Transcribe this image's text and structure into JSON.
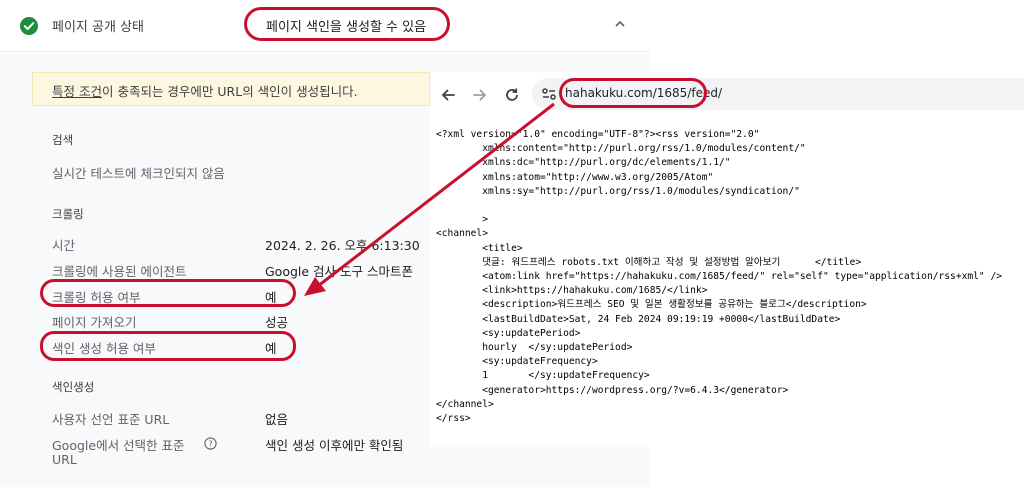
{
  "status": {
    "label": "페이지 공개 상태",
    "value": "페이지 색인을 생성할 수 있음"
  },
  "notice": {
    "link_text": "특정 조건",
    "rest_text": "이 충족되는 경우에만 URL의 색인이 생성됩니다."
  },
  "sections": {
    "search": {
      "title": "검색",
      "realtime": "실시간 테스트에 체크인되지 않음"
    },
    "crawling": {
      "title": "크롤링",
      "rows": [
        {
          "label": "시간",
          "value": "2024. 2. 26. 오후 6:13:30"
        },
        {
          "label": "크롤링에 사용된 에이전트",
          "value": "Google 검사 도구 스마트폰"
        },
        {
          "label": "크롤링 허용 여부",
          "value": "예"
        },
        {
          "label": "페이지 가져오기",
          "value": "성공"
        },
        {
          "label": "색인 생성 허용 여부",
          "value": "예"
        }
      ]
    },
    "indexing": {
      "title": "색인생성",
      "rows": [
        {
          "label": "사용자 선언 표준 URL",
          "value": "없음"
        },
        {
          "label": "Google에서 선택한 표준",
          "label2": "URL",
          "value": "색인 생성 이후에만 확인됨"
        }
      ]
    }
  },
  "browser": {
    "url": "hahakuku.com/1685/feed/",
    "xml_lines": [
      "<?xml version=\"1.0\" encoding=\"UTF-8\"?><rss version=\"2.0\"",
      "        xmlns:content=\"http://purl.org/rss/1.0/modules/content/\"",
      "        xmlns:dc=\"http://purl.org/dc/elements/1.1/\"",
      "        xmlns:atom=\"http://www.w3.org/2005/Atom\"",
      "        xmlns:sy=\"http://purl.org/rss/1.0/modules/syndication/\"",
      "",
      "        >",
      "<channel>",
      "        <title>",
      "        댓글: 워드프레스 robots.txt 이해하고 작성 및 설정방법 알아보기      </title>",
      "        <atom:link href=\"https://hahakuku.com/1685/feed/\" rel=\"self\" type=\"application/rss+xml\" />",
      "        <link>https://hahakuku.com/1685/</link>",
      "        <description>워드프레스 SEO 및 일본 생활정보를 공유하는 블로그</description>",
      "        <lastBuildDate>Sat, 24 Feb 2024 09:19:19 +0000</lastBuildDate>",
      "        <sy:updatePeriod>",
      "        hourly  </sy:updatePeriod>",
      "        <sy:updateFrequency>",
      "        1       </sy:updateFrequency>",
      "        <generator>https://wordpress.org/?v=6.4.3</generator>",
      "</channel>",
      "</rss>"
    ]
  },
  "colors": {
    "check_green": "#1e8e3e",
    "annotation_red": "#c8102e",
    "notice_bg": "#fef7e0"
  },
  "icons": [
    "check-circle-icon",
    "chevron-up-icon",
    "help-circle-icon",
    "back-arrow-icon",
    "forward-arrow-icon",
    "reload-icon",
    "site-settings-icon"
  ]
}
